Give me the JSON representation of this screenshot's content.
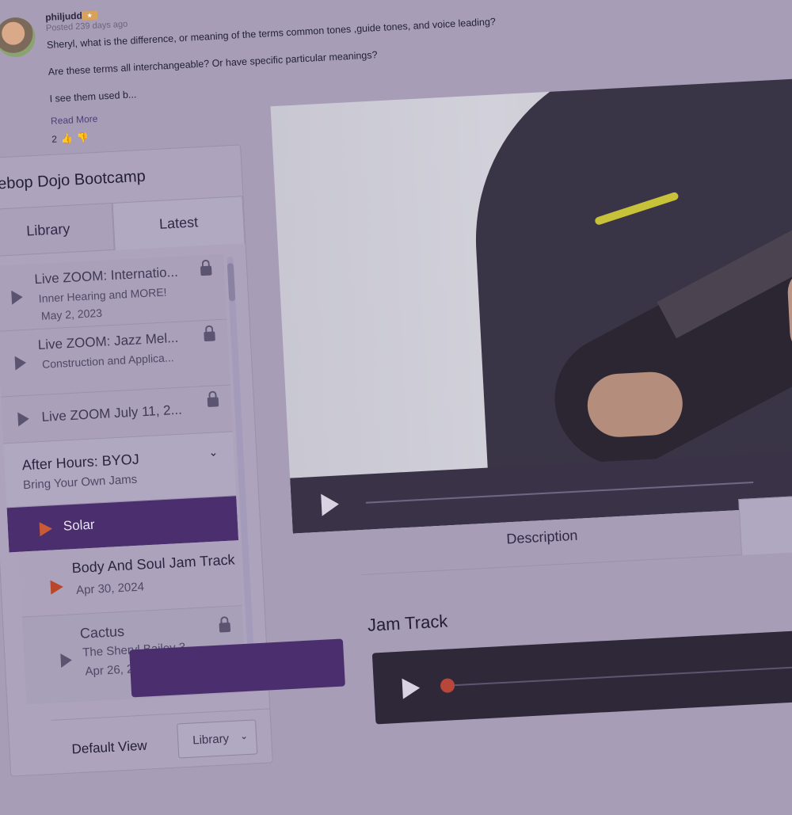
{
  "comment": {
    "username": "philjudd",
    "posted": "Posted 239 days ago",
    "body": [
      "Sheryl, what is the difference, or meaning of the terms common tones ,guide tones, and voice leading?",
      "Are these terms all interchangeable? Or have specific particular meanings?",
      "I see them used b..."
    ],
    "read_more": "Read More",
    "likes": "2"
  },
  "sidebar": {
    "title": "ebop Dojo Bootcamp",
    "tabs": [
      "Library",
      "Latest"
    ],
    "items": [
      {
        "title": "Live ZOOM: Internatio...",
        "subtitle": "Inner Hearing and MORE!",
        "date": "May 2, 2023"
      },
      {
        "title": "Live ZOOM: Jazz Mel...",
        "subtitle": "Construction and Applica..."
      },
      {
        "title": "Live ZOOM July 11, 2..."
      }
    ],
    "group": {
      "title": "After Hours: BYOJ",
      "subtitle": "Bring Your Own Jams"
    },
    "active_item": "Solar",
    "sub_items": [
      {
        "title": "Body And Soul Jam Track",
        "date": "Apr 30, 2024"
      },
      {
        "title": "Cactus",
        "subtitle": "The Sheryl Bailey 3",
        "date": "Apr 26, 2019"
      }
    ],
    "default_view_label": "Default View",
    "default_view_value": "Library"
  },
  "main": {
    "description_tab": "Description",
    "jam_track_title": "Jam Track"
  },
  "colors": {
    "accent": "#4a2e6e",
    "play_accent": "#c85a35"
  }
}
